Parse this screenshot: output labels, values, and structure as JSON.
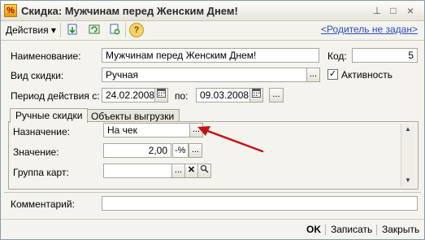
{
  "window": {
    "title": "Скидка: Мужчинам перед Женским Днем!",
    "colors": {
      "title": "#2a2a2a",
      "link": "#2a4bc8",
      "arrow": "#c0161a"
    }
  },
  "toolbar": {
    "actions_label": "Действия",
    "actions_arrow": "▾",
    "help_icon": "?",
    "parent_link": "<Родитель не задан>"
  },
  "form": {
    "name_label": "Наименование:",
    "name_value": "Мужчинам перед Женским Днем!",
    "code_label": "Код:",
    "code_value": "5",
    "type_label": "Вид скидки:",
    "type_value": "Ручная",
    "active_label": "Активность",
    "active_checked": "✓",
    "period_label": "Период действия с:",
    "period_from": "24.02.2008",
    "period_to_label": "по:",
    "period_to": "09.03.2008",
    "comment_label": "Комментарий:",
    "comment_value": ""
  },
  "tabs": [
    {
      "label": "Ручные скидки"
    },
    {
      "label": "Объекты выгрузки"
    }
  ],
  "tab_manual": {
    "purpose_label": "Назначение:",
    "purpose_value": "На чек",
    "value_label": "Значение:",
    "value_value": "2,00",
    "unit_value": "-%",
    "card_group_label": "Группа карт:",
    "card_group_value": ""
  },
  "buttons": {
    "select": "...",
    "clear": "✕",
    "search_icon": "⚲",
    "ok": "OK",
    "save": "Записать",
    "close": "Закрыть"
  }
}
